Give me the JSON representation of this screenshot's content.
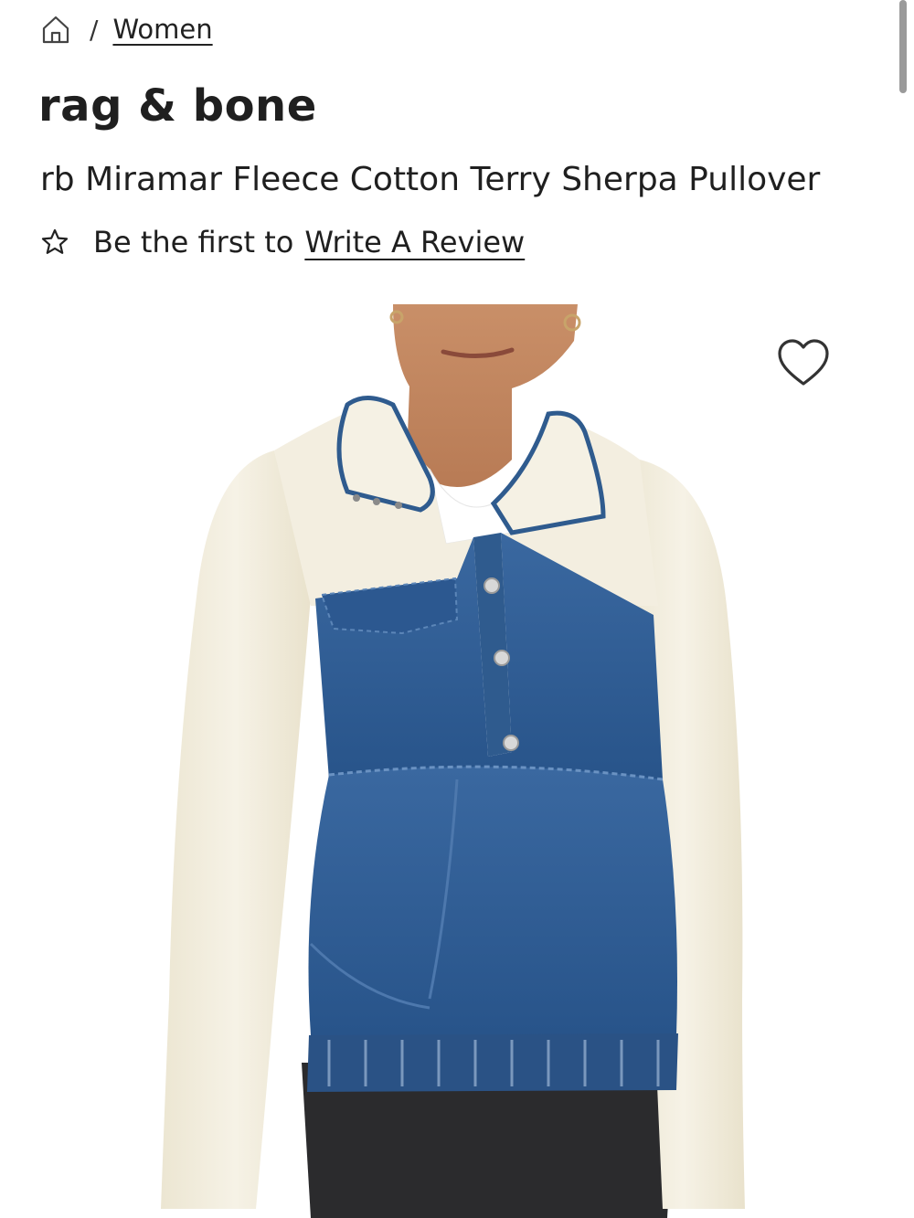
{
  "breadcrumb": {
    "home_icon": "home-icon",
    "separator": "/",
    "category": "Women"
  },
  "product": {
    "brand": "rag & bone",
    "name": "rb Miramar Fleece Cotton Terry Sherpa Pullover",
    "review_prefix": "Be the first to",
    "review_link": "Write A Review",
    "star_icon": "star-outline-icon",
    "wishlist_icon": "heart-outline-icon"
  },
  "colors": {
    "text": "#1f1f1f",
    "denim": "#2f5b8e",
    "sherpa": "#f1ecdc",
    "background": "#ffffff"
  }
}
